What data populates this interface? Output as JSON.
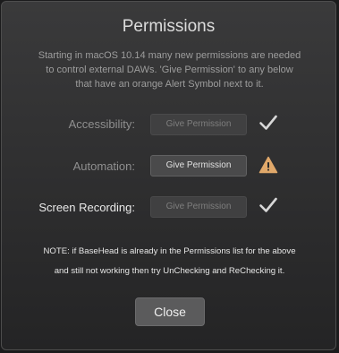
{
  "dialog": {
    "title": "Permissions",
    "description_lines": [
      "Starting in macOS 10.14 many new permissions are needed",
      "to control external DAWs.  'Give Permission' to any below",
      "that have an orange Alert Symbol next to it."
    ],
    "permissions": [
      {
        "label": "Accessibility:",
        "button": "Give Permission",
        "enabled": false,
        "status": "checkmark-icon"
      },
      {
        "label": "Automation:",
        "button": "Give Permission",
        "enabled": true,
        "status": "alert-triangle-icon"
      },
      {
        "label": "Screen Recording:",
        "button": "Give Permission",
        "enabled": false,
        "status": "checkmark-icon"
      }
    ],
    "note_lines": [
      "NOTE: if BaseHead is already in the Permissions list for the above",
      "and still not working then try UnChecking and ReChecking it."
    ],
    "close_label": "Close",
    "colors": {
      "alert": "#e0a86a",
      "check": "#d8d8d8"
    }
  }
}
